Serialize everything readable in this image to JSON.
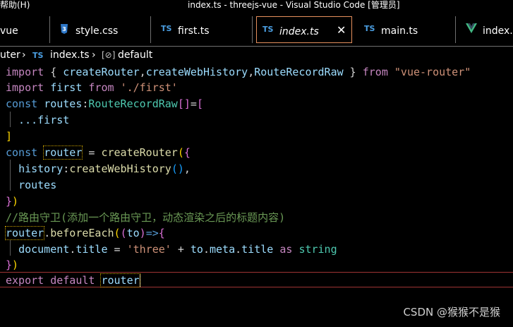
{
  "titlebar": {
    "menu_label": "帮助(H)",
    "window_title": "index.ts - threejs-vue - Visual Studio Code [管理员]"
  },
  "tabs": [
    {
      "label": "vue",
      "icon": "vue-icon"
    },
    {
      "label": "style.css",
      "icon": "css-icon"
    },
    {
      "label": "first.ts",
      "icon": "ts-icon"
    },
    {
      "label": "index.ts",
      "icon": "ts-icon",
      "active": true
    },
    {
      "label": "main.ts",
      "icon": "ts-icon"
    },
    {
      "label": "index.v",
      "icon": "vue-icon"
    }
  ],
  "icons": {
    "ts": "TS",
    "css": "3",
    "vue": "V",
    "close": "✕",
    "chevron": "›",
    "symbol": "[⊘]"
  },
  "breadcrumb": {
    "folder": "uter",
    "file": "index.ts",
    "symbol": "default"
  },
  "code": {
    "l1": {
      "a": "import",
      "b": " { ",
      "c": "createRouter",
      "d": ",",
      "e": "createWebHistory",
      "f": ",",
      "g": "RouteRecordRaw",
      "h": " } ",
      "i": "from",
      "j": " ",
      "k": "\"vue-router\""
    },
    "l2": {
      "a": "import",
      "b": " first ",
      "c": "from",
      "d": " ",
      "e": "'./first'"
    },
    "l3": {
      "a": "const",
      "b": " ",
      "c": "routes",
      "d": ":",
      "e": "RouteRecordRaw",
      "f": "[]",
      "g": "=",
      "h": "["
    },
    "l4": {
      "a": "  ...first"
    },
    "l5": {
      "a": "]"
    },
    "l6": {
      "a": "const",
      "b": " ",
      "c": "router",
      "d": " = ",
      "e": "createRouter",
      "f": "(",
      "g": "{"
    },
    "l7": {
      "a": "  ",
      "b": "history",
      "c": ":",
      "d": "createWebHistory",
      "e": "()",
      "f": ","
    },
    "l8": {
      "a": "  ",
      "b": "routes"
    },
    "l9": {
      "a": "}",
      "b": ")"
    },
    "l10": {
      "a": "//路由守卫(添加一个路由守卫，动态渲染之后的标题内容)"
    },
    "l11": {
      "a": "router",
      "b": ".",
      "c": "beforeEach",
      "d": "(",
      "e": "(",
      "f": "to",
      "g": ")",
      "h": "=>",
      "i": "{"
    },
    "l12": {
      "a": "  ",
      "b": "document",
      "c": ".",
      "d": "title",
      "e": " = ",
      "f": "'three'",
      "g": " + ",
      "h": "to",
      "i": ".",
      "j": "meta",
      "k": ".",
      "l": "title",
      "m": " ",
      "n": "as",
      "o": " ",
      "p": "string"
    },
    "l13": {
      "a": "}",
      "b": ")"
    },
    "l14": {
      "a": "export",
      "b": " ",
      "c": "default",
      "d": " ",
      "e": "router"
    }
  },
  "watermark": "CSDN @猴猴不是猴",
  "colors": {
    "keyword": "#c586c0",
    "keyword2": "#569cd6",
    "function": "#dcdcaa",
    "variable": "#9cdcfe",
    "type": "#4ec9b0",
    "string": "#ce9178",
    "comment": "#6a9955",
    "active_tab_border": "#e58f5d"
  }
}
